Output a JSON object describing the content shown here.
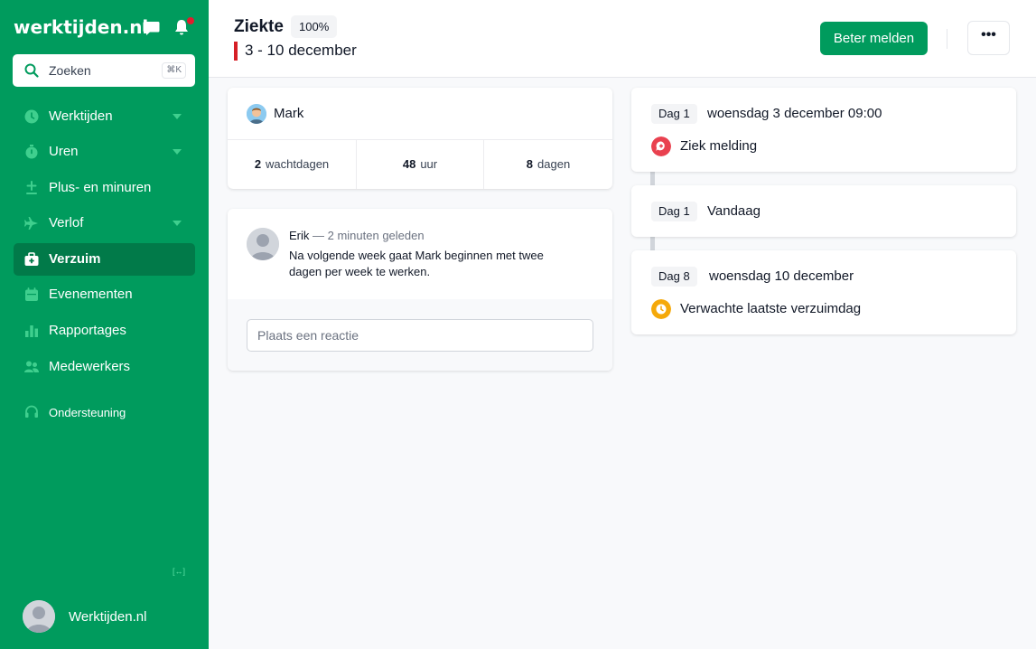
{
  "app": {
    "logo_text": "werktijden.nl",
    "colors": {
      "brand": "#009b5d",
      "active_nav": "#017a49",
      "danger": "#d61f26",
      "warning": "#f5a90a",
      "notice": "#e9414f"
    }
  },
  "sidebar": {
    "search": {
      "label": "Zoeken",
      "shortcut": "⌘K"
    },
    "nav": [
      {
        "label": "Werktijden",
        "icon": "clock-icon",
        "has_caret": true
      },
      {
        "label": "Uren",
        "icon": "stopwatch-icon",
        "has_caret": true
      },
      {
        "label": "Plus- en minuren",
        "icon": "plus-minus-icon",
        "has_caret": false
      },
      {
        "label": "Verlof",
        "icon": "airplane-icon",
        "has_caret": true
      },
      {
        "label": "Verzuim",
        "icon": "medical-kit-icon",
        "has_caret": false,
        "active": true
      },
      {
        "label": "Evenementen",
        "icon": "calendar-icon",
        "has_caret": false
      },
      {
        "label": "Rapportages",
        "icon": "bar-chart-icon",
        "has_caret": false
      },
      {
        "label": "Medewerkers",
        "icon": "users-icon",
        "has_caret": false
      }
    ],
    "support_label": "Ondersteuning",
    "collapse_label": "[↔]",
    "user": {
      "name": "Werktijden.nl"
    }
  },
  "header": {
    "title": "Ziekte",
    "percentage": "100%",
    "date_range": "3 - 10 december",
    "primary_button": "Beter melden",
    "more_button": "•••"
  },
  "person": {
    "name": "Mark",
    "stats": [
      {
        "value": "2",
        "unit": "wachtdagen"
      },
      {
        "value": "48",
        "unit": "uur"
      },
      {
        "value": "8",
        "unit": "dagen"
      }
    ]
  },
  "comment": {
    "author": "Erik",
    "time": "— 2 minuten geleden",
    "text": "Na volgende week gaat Mark beginnen met twee dagen per week te werken.",
    "reply_placeholder": "Plaats een reactie"
  },
  "timeline": [
    {
      "day": "Dag 1",
      "heading": "woensdag 3 december 09:00",
      "event": "Ziek melding",
      "event_icon": "sick-report-icon"
    },
    {
      "day": "Dag 1",
      "heading": "Vandaag"
    },
    {
      "day": "Dag 8",
      "heading": "woensdag 10 december",
      "event": "Verwachte laatste verzuimdag",
      "event_icon": "clock-icon"
    }
  ]
}
